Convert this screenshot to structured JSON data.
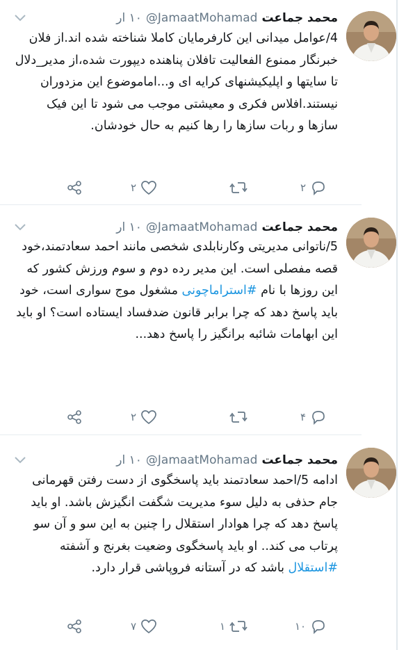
{
  "tweets": [
    {
      "name": "محمد جماعت",
      "handle": "@JamaatMohamad",
      "time": "۱۰ ار",
      "text": "4/عوامل میدانی این کارفرمایان کاملا شناخته شده اند.از فلان خبرنگار ممنوع الفعالیت تافلان پناهنده دیپورت شده،از مدیر_دلال تا سایتها و اپلیکیشنهای کرایه ای و...اماموضوع این مزدوران نیستند.افلاس فکری و معیشتی موجب می شود تا این فیک سازها و ربات سازها را رها کنیم به حال خودشان.",
      "hashtag": "",
      "text_after": "",
      "replies": "۲",
      "retweets": "",
      "likes": "۲"
    },
    {
      "name": "محمد جماعت",
      "handle": "@JamaatMohamad",
      "time": "۱۰ ار",
      "text": "5/ناتوانی مدیریتی وکارنابلدی شخصی مانند احمد سعادتمند،خود قصه مفصلی است. این مدیر رده دوم و سوم ورزش کشور که این روزها با نام ",
      "hashtag": "#استراماچونی",
      "text_after": " مشغول موج سواری است، خود باید پاسخ دهد که چرا برابر قانون ضدفساد ایستاده است؟ او باید این ابهامات شائبه برانگیز را پاسخ دهد...",
      "replies": "۴",
      "retweets": "",
      "likes": "۲"
    },
    {
      "name": "محمد جماعت",
      "handle": "@JamaatMohamad",
      "time": "۱۰ ار",
      "text": "ادامه 5/احمد سعادتمند باید پاسخگوی از دست رفتن قهرمانی جام حذفی به دلیل سوء مدیریت شگفت انگیزش باشد. او باید پاسخ دهد که چرا هوادار استقلال را چنین به این سو و آن سو پرتاب می کند.. او باید پاسخگوی وضعیت بغرنج و آشفته ",
      "hashtag": "#استقلال",
      "text_after": " باشد که در آستانه فروپاشی قرار دارد.",
      "replies": "۱۰",
      "retweets": "۱",
      "likes": "۷"
    }
  ],
  "icons": {
    "reply": "reply-icon",
    "retweet": "retweet-icon",
    "like": "heart-icon",
    "share": "share-icon",
    "menu": "chevron-down-icon"
  },
  "colors": {
    "text": "#14171a",
    "secondary": "#657786",
    "hashtag": "#1b95e0",
    "divider": "#e6ecf0"
  }
}
